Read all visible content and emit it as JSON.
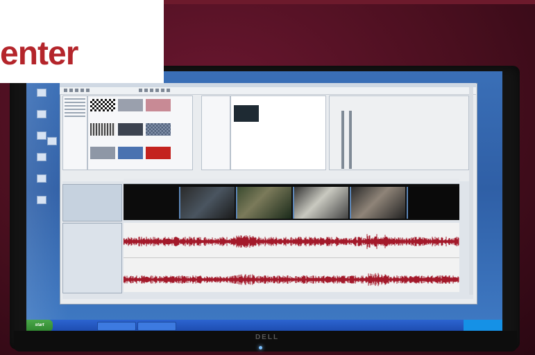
{
  "sign": {
    "text": "enter",
    "text_color": "#b4252b",
    "background": "#ffffff"
  },
  "monitor": {
    "brand": "DELL"
  },
  "taskbar": {
    "start_label": "start"
  },
  "colors": {
    "wall": "#4a0f1f",
    "desktop": "#3a6fb7",
    "waveform": "#a3192a",
    "app_background": "#e9ecef"
  },
  "icons": [
    "desktop-shortcut-icon",
    "waveform",
    "video-thumbnail"
  ]
}
